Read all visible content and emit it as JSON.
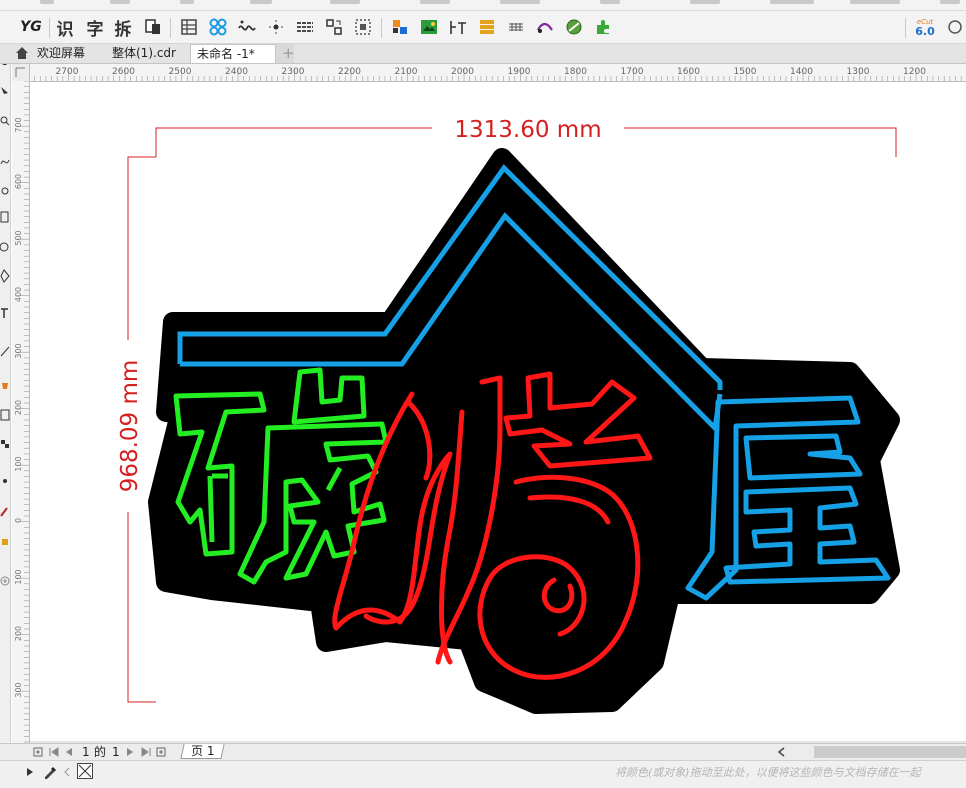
{
  "tabs": [
    {
      "label": "欢迎屏幕",
      "active": false
    },
    {
      "label": "整体(1).cdr",
      "active": false
    },
    {
      "label": "未命名 -1*",
      "active": true
    }
  ],
  "tab_add_label": "+",
  "toolbar": {
    "yg_label": "YG",
    "text_tools": [
      "识",
      "字",
      "拆"
    ],
    "version_badge": "6.0"
  },
  "ruler": {
    "h_ticks": [
      "2700",
      "2600",
      "2500",
      "2400",
      "2300",
      "2200",
      "2100",
      "2000",
      "1900",
      "1800",
      "1700",
      "1600",
      "1500",
      "1400",
      "1300",
      "1200"
    ],
    "v_ticks": [
      "700",
      "600",
      "500",
      "400",
      "300",
      "200",
      "100",
      "0",
      "100",
      "200",
      "300"
    ]
  },
  "drawing": {
    "dimension_width": "1313.60 mm",
    "dimension_height": "968.09 mm",
    "chars": [
      "碳",
      "烤",
      "屋"
    ],
    "colors": {
      "green": "#22ee22",
      "red": "#ff1616",
      "blue": "#16a0e6",
      "black": "#000000",
      "dim": "#d42020"
    }
  },
  "pager": {
    "current": "1",
    "of": "的",
    "total": "1",
    "page_tab": "页 1"
  },
  "status": {
    "hint": "将颜色(或对象)拖动至此处，以便将这些颜色与文档存储在一起"
  }
}
